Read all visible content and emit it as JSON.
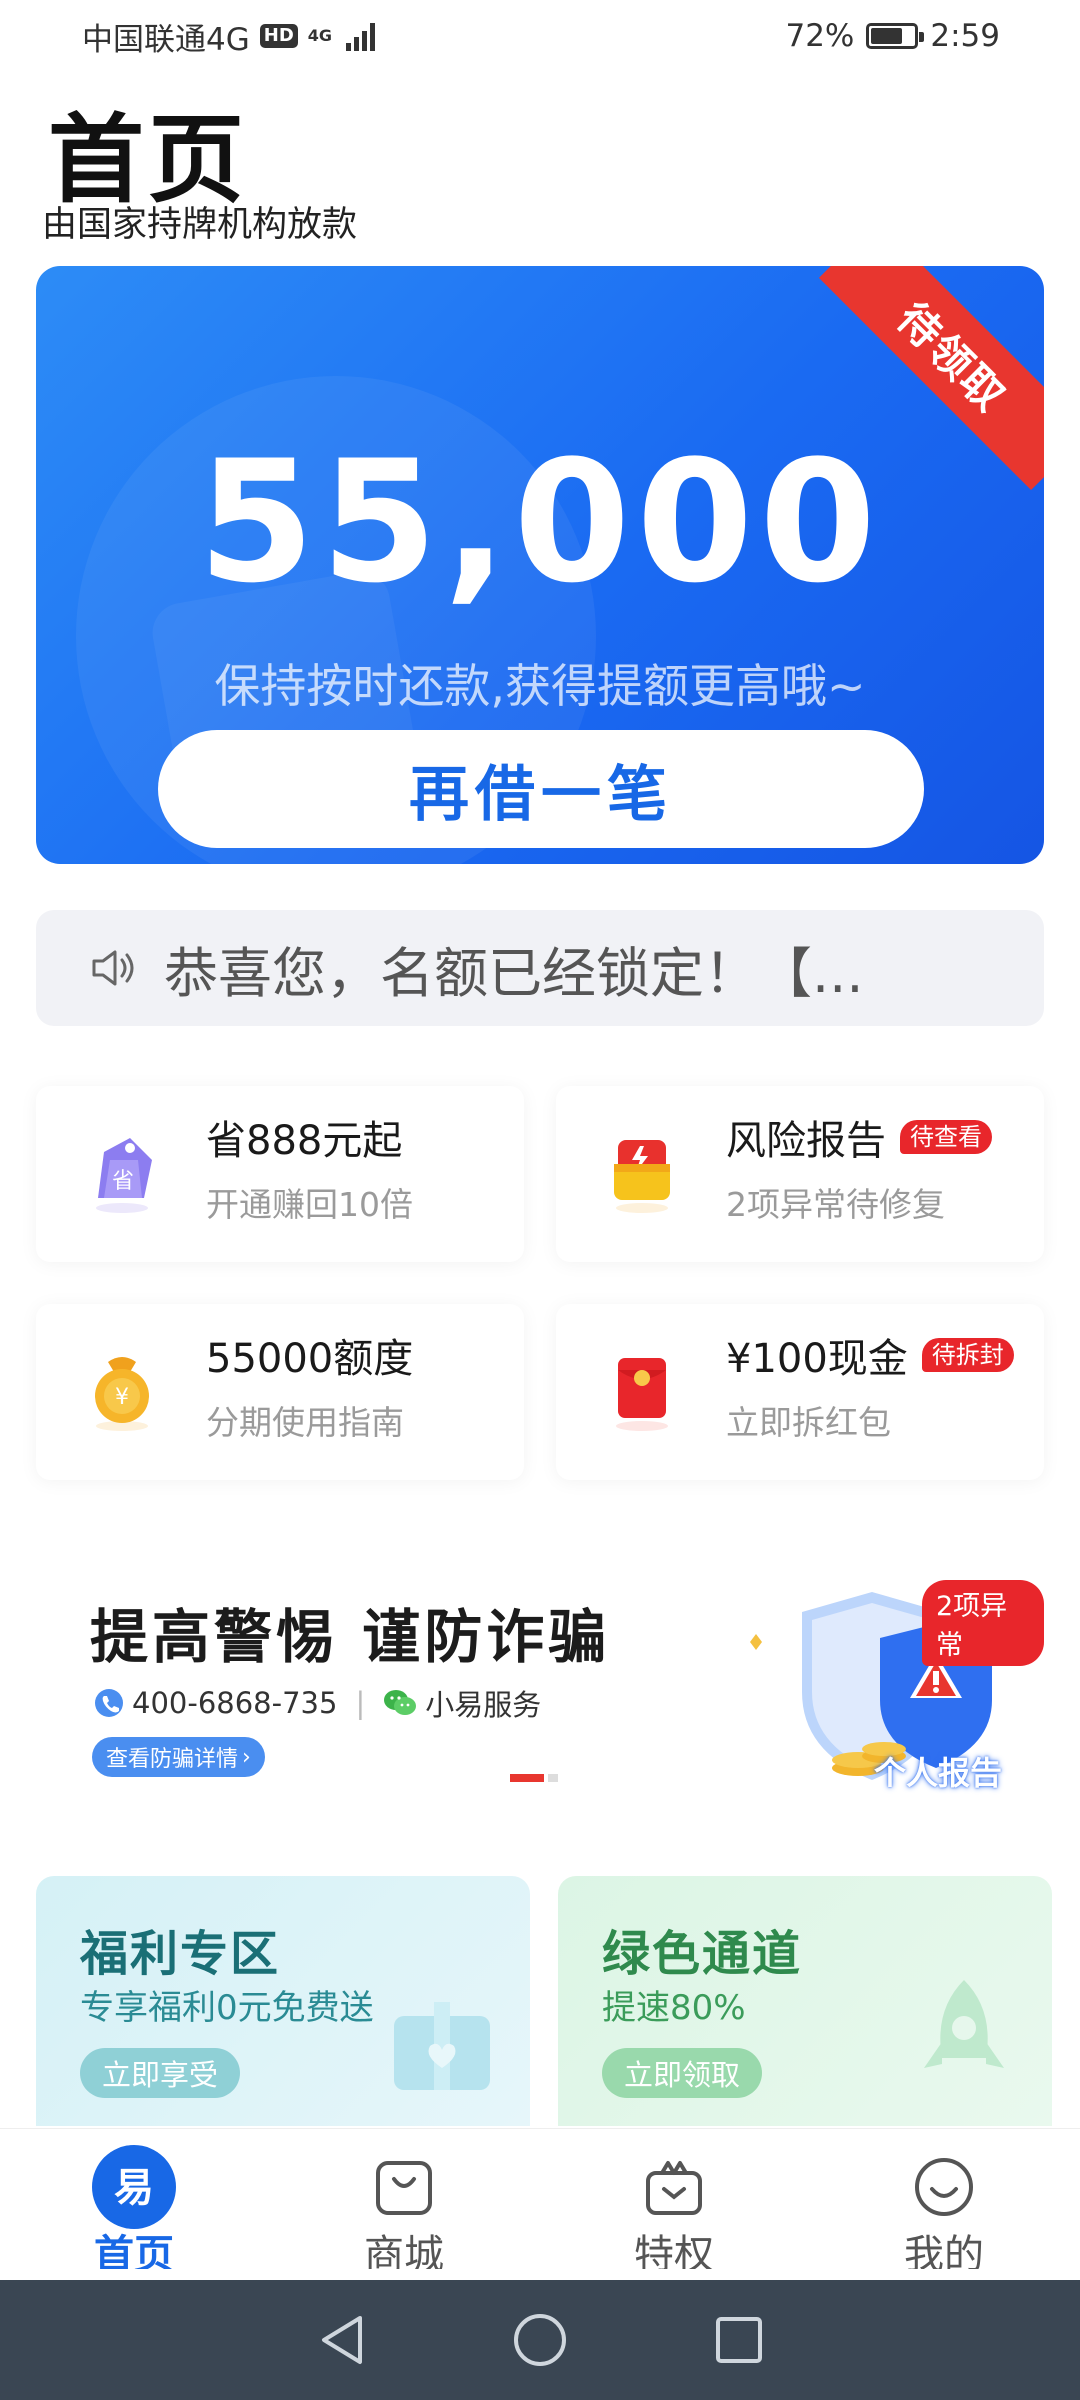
{
  "status_bar": {
    "carrier": "中国联通4G",
    "hd": "HD",
    "net": "4G",
    "battery": "72%",
    "battery_level": 0.72,
    "time": "2:59"
  },
  "header": {
    "title": "首页",
    "subtitle": "由国家持牌机构放款"
  },
  "hero": {
    "ribbon": "待领取",
    "amount": "55,000",
    "tip": "保持按时还款,获得提额更高哦~",
    "button": "再借一笔"
  },
  "notice": {
    "text": "恭喜您，名额已经锁定！【..."
  },
  "features": [
    {
      "title": "省888元起",
      "subtitle": "开通赚回10倍",
      "badge": "",
      "icon": "savings-tag-icon"
    },
    {
      "title": "风险报告",
      "subtitle": "2项异常待修复",
      "badge": "待查看",
      "icon": "risk-report-icon"
    },
    {
      "title": "55000额度",
      "subtitle": "分期使用指南",
      "badge": "",
      "icon": "money-bag-icon"
    },
    {
      "title": "¥100现金",
      "subtitle": "立即拆红包",
      "badge": "待拆封",
      "icon": "red-envelope-icon"
    }
  ],
  "banner": {
    "title": "提高警惕 谨防诈骗",
    "phone": "400-6868-735",
    "service": "小易服务",
    "link": "查看防骗详情",
    "badge": "2项异常",
    "report": "个人报告"
  },
  "promos": [
    {
      "title": "福利专区",
      "subtitle": "专享福利0元免费送",
      "button": "立即享受"
    },
    {
      "title": "绿色通道",
      "subtitle": "提速80%",
      "button": "立即领取"
    }
  ],
  "bottom_nav": [
    {
      "label": "首页",
      "icon_char": "易",
      "active": true
    },
    {
      "label": "商城",
      "active": false
    },
    {
      "label": "特权",
      "active": false
    },
    {
      "label": "我的",
      "active": false
    }
  ],
  "colors": {
    "brand_blue": "#1868e6",
    "badge_red": "#e8262b",
    "ribbon_red": "#e8362f",
    "system_nav": "#3a4653"
  }
}
